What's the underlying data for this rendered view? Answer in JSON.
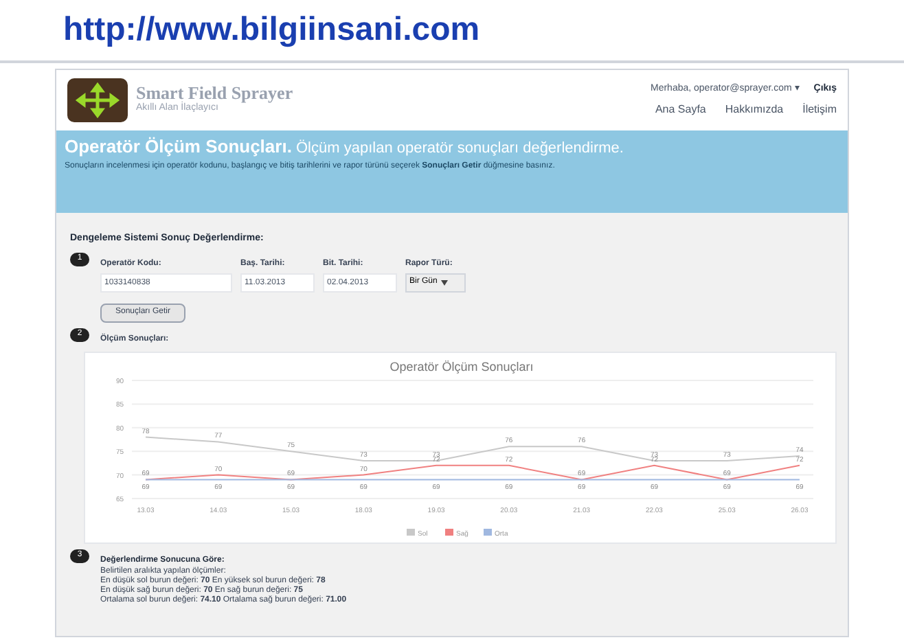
{
  "page_header": {
    "url": "http://www.bilgiinsani.com"
  },
  "site_header": {
    "title": "Smart Field Sprayer",
    "subtitle": "Akıllı Alan İlaçlayıcı",
    "user": "Merhaba, operator@sprayer.com ▾",
    "logout": "Çıkış",
    "nav": [
      {
        "label": "Ana Sayfa"
      },
      {
        "label": "Hakkımızda"
      },
      {
        "label": "İletişim"
      }
    ]
  },
  "banner": {
    "title": "Operatör Ölçüm Sonuçları.",
    "subtitle": "Ölçüm yapılan operatör sonuçları değerlendirme.",
    "description": "Sonuçların incelenmesi için operatör kodunu, başlangıç ve bitiş tarihlerini ve rapor türünü seçerek **Sonuçları Getir** düğmesine basınız."
  },
  "section_title": "Dengeleme Sistemi Sonuç Değerlendirme:",
  "steps": [
    {
      "number": "1",
      "kind": "form",
      "fields": [
        {
          "label": "Operatör Kodu:",
          "value": "1033140838",
          "kind": "text"
        },
        {
          "label": "Baş. Tarihi:",
          "value": "11.03.2013",
          "kind": "date"
        },
        {
          "label": "Bit. Tarihi:",
          "value": "02.04.2013",
          "kind": "date"
        },
        {
          "label": "Rapor Türü:",
          "value": "Bir Gün",
          "kind": "select"
        }
      ],
      "button": "Sonuçları Getir"
    },
    {
      "number": "2",
      "kind": "chart",
      "title": "Ölçüm Sonuçları:",
      "chart_data": {
        "type": "line",
        "title": "Operatör Ölçüm Sonuçları",
        "categories": [
          "13.03",
          "14.03",
          "15.03",
          "18.03",
          "19.03",
          "20.03",
          "21.03",
          "22.03",
          "25.03",
          "26.03"
        ],
        "series": [
          {
            "name": "Sol",
            "color": "#c8c8c8",
            "values": [
              78,
              77,
              75,
              73,
              73,
              76,
              76,
              73,
              73,
              74
            ]
          },
          {
            "name": "Sağ",
            "color": "#f08080",
            "values": [
              69,
              70,
              69,
              70,
              72,
              72,
              69,
              72,
              69,
              72
            ]
          },
          {
            "name": "Orta",
            "color": "#a0b8e0",
            "values": [
              69,
              69,
              69,
              69,
              69,
              69,
              69,
              69,
              69,
              69
            ]
          }
        ],
        "ylim": [
          65,
          90
        ],
        "grid": true,
        "legend": "bottom",
        "yticks": [
          65,
          70,
          75,
          80,
          85,
          90
        ],
        "data_labels": true
      }
    },
    {
      "number": "3",
      "kind": "text",
      "title": "Değerlendirme Sonucuna Göre:",
      "lines": [
        "Belirtilen aralıkta yapılan ölçümler:",
        "En düşük sol burun değeri: **70** En yüksek sol burun değeri: **78**",
        "En düşük sağ burun değeri: **70** En sağ burun değeri: **75**",
        "Ortalama sol burun değeri: **74.10** Ortalama sağ burun değeri: **71.00**"
      ]
    }
  ]
}
